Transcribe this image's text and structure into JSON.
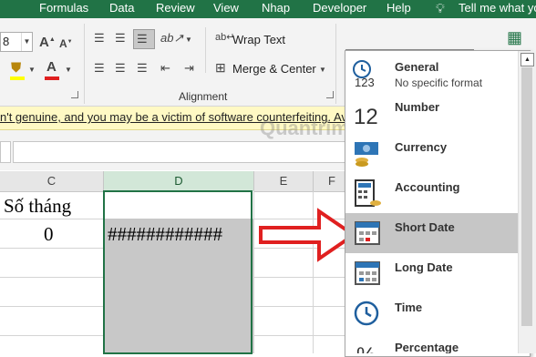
{
  "tabs": {
    "formulas": "Formulas",
    "data": "Data",
    "review": "Review",
    "view": "View",
    "nhap": "Nhap",
    "developer": "Developer",
    "help": "Help",
    "tell_me": "Tell me what yo"
  },
  "ribbon": {
    "font_size": "8",
    "wrap_text": "Wrap Text",
    "merge_center": "Merge & Center",
    "alignment_label": "Alignment",
    "number_format_value": ""
  },
  "message_bar": {
    "text": "n't genuine, and you may be a victim of software counterfeiting. Avoid"
  },
  "columns": {
    "c": "C",
    "d": "D",
    "e": "E",
    "f": "F"
  },
  "cells": {
    "c1": "Số tháng",
    "c2": "0",
    "d2": "############"
  },
  "format_menu": {
    "items": [
      {
        "title": "General",
        "subtitle": "No specific format",
        "icon": "general-icon"
      },
      {
        "title": "Number",
        "subtitle": "",
        "icon": "number-icon"
      },
      {
        "title": "Currency",
        "subtitle": "",
        "icon": "currency-icon"
      },
      {
        "title": "Accounting",
        "subtitle": "",
        "icon": "accounting-icon"
      },
      {
        "title": "Short Date",
        "subtitle": "",
        "icon": "short-date-icon"
      },
      {
        "title": "Long Date",
        "subtitle": "",
        "icon": "long-date-icon"
      },
      {
        "title": "Time",
        "subtitle": "",
        "icon": "time-icon"
      },
      {
        "title": "Percentage",
        "subtitle": "",
        "icon": "percentage-icon"
      }
    ],
    "highlighted": "Short Date"
  },
  "colors": {
    "excel_green": "#217346",
    "highlight": "#c6c6c6",
    "arrow_red": "#e02020"
  }
}
